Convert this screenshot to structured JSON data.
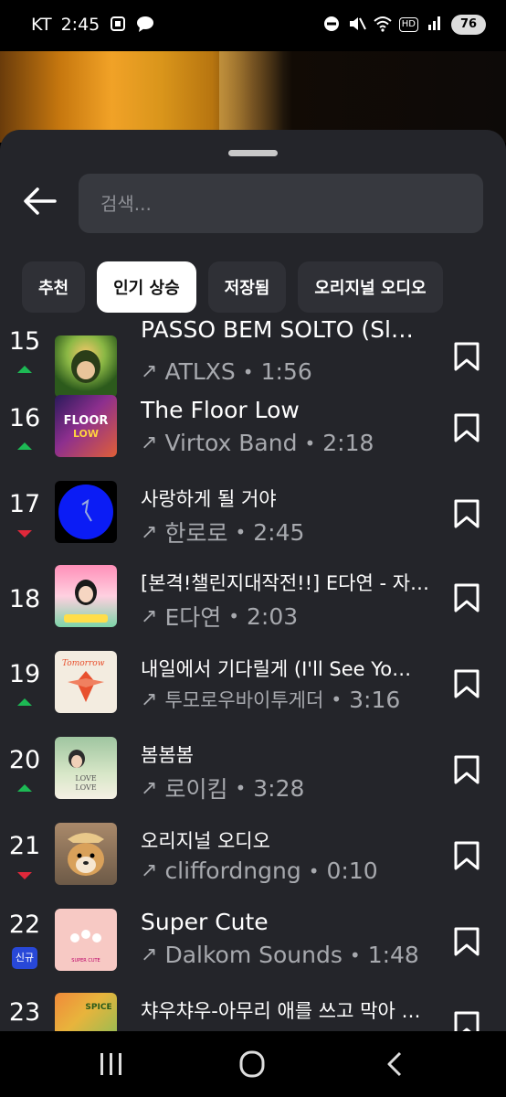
{
  "status_bar": {
    "carrier": "KT",
    "time": "2:45",
    "left_icons": [
      "screenshot-icon",
      "chat-bubble-icon"
    ],
    "right_icons": [
      "do-not-disturb-icon",
      "mute-icon",
      "wifi-icon",
      "hd-icon",
      "signal-icon"
    ],
    "hd_label": "HD",
    "battery": "76"
  },
  "search": {
    "placeholder": "검색..."
  },
  "tabs": [
    {
      "label": "추천",
      "active": false
    },
    {
      "label": "인기 상승",
      "active": true
    },
    {
      "label": "저장됨",
      "active": false
    },
    {
      "label": "오리지널 오디오",
      "active": false
    }
  ],
  "tracks": [
    {
      "rank": "15",
      "trend": "up",
      "title": "PASSO BEM SOLTO (Sl…",
      "artist": "ATLXS",
      "duration": "1:56",
      "thumb": "anime-boy-green"
    },
    {
      "rank": "16",
      "trend": "up",
      "title": "The Floor Low",
      "artist": "Virtox Band",
      "duration": "2:18",
      "thumb": "floor-low-cover"
    },
    {
      "rank": "17",
      "trend": "down",
      "title": "사랑하게 될 거야",
      "artist": "한로로",
      "duration": "2:45",
      "thumb": "blue-circle-cover"
    },
    {
      "rank": "18",
      "trend": "none",
      "title": "[본격!챌린지대작전!!] E다연 - 자…",
      "artist": "E다연",
      "duration": "2:03",
      "thumb": "pink-girl-cover"
    },
    {
      "rank": "19",
      "trend": "up",
      "title": "내일에서 기다릴게 (I'll See Yo…",
      "artist": "투모로우바이투게더",
      "duration": "3:16",
      "thumb": "tomorrow-cover"
    },
    {
      "rank": "20",
      "trend": "up",
      "title": "봄봄봄",
      "artist": "로이킴",
      "duration": "3:28",
      "thumb": "love-cover"
    },
    {
      "rank": "21",
      "trend": "down",
      "title": "오리지널 오디오",
      "artist": "cliffordngng",
      "duration": "0:10",
      "thumb": "dog-cover"
    },
    {
      "rank": "22",
      "trend": "new",
      "new_label": "신규",
      "title": "Super Cute",
      "artist": "Dalkom Sounds",
      "duration": "1:48",
      "thumb": "pink-cute-cover"
    },
    {
      "rank": "23",
      "trend": "none",
      "title": "챠우챠우-아무리 애를 쓰고 막아 보…",
      "artist": "",
      "duration": "",
      "thumb": "green-spice-cover"
    }
  ],
  "separator": "•",
  "navbar": {
    "buttons": [
      "recent-apps-icon",
      "home-icon",
      "back-nav-icon"
    ]
  }
}
